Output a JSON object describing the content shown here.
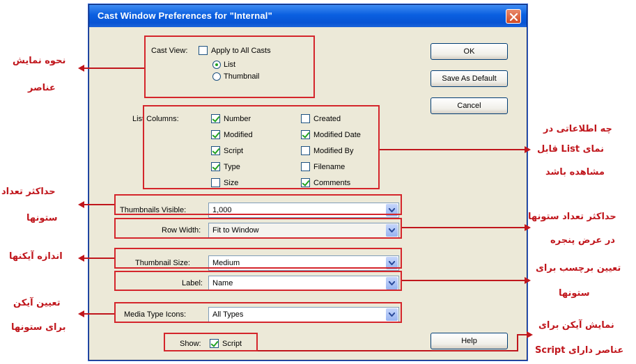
{
  "dialog": {
    "title": "Cast Window Preferences for \"Internal\"",
    "cast_view_label": "Cast View:",
    "apply_all_label": "Apply to All Casts",
    "apply_all_checked": false,
    "view_list_label": "List",
    "view_thumbnail_label": "Thumbnail",
    "selected_view": "List",
    "list_columns_label": "List Columns:",
    "columns": [
      {
        "label": "Number",
        "checked": true
      },
      {
        "label": "Modified",
        "checked": true
      },
      {
        "label": "Script",
        "checked": true
      },
      {
        "label": "Type",
        "checked": true
      },
      {
        "label": "Size",
        "checked": false
      },
      {
        "label": "Created",
        "checked": false
      },
      {
        "label": "Modified Date",
        "checked": true
      },
      {
        "label": "Modified By",
        "checked": false
      },
      {
        "label": "Filename",
        "checked": false
      },
      {
        "label": "Comments",
        "checked": true
      }
    ],
    "thumbnails_visible_label": "Thumbnails Visible:",
    "thumbnails_visible_value": "1,000",
    "row_width_label": "Row Width:",
    "row_width_value": "Fit to Window",
    "thumbnail_size_label": "Thumbnail Size:",
    "thumbnail_size_value": "Medium",
    "label_label": "Label:",
    "label_value": "Name",
    "media_type_icons_label": "Media Type Icons:",
    "media_type_icons_value": "All Types",
    "show_label": "Show:",
    "show_script_label": "Script",
    "show_script_checked": true,
    "ok_label": "OK",
    "save_default_label": "Save As Default",
    "cancel_label": "Cancel",
    "help_label": "Help"
  },
  "annotations": {
    "cast_view_line1": "نحوه نمایش",
    "cast_view_line2": "عناصر",
    "list_columns_line1": "چه اطلاعاتی در",
    "list_columns_line2": "نمای List قابل",
    "list_columns_line3": "مشاهده باشد",
    "thumbnails_line1": "حداکثر تعداد",
    "thumbnails_line2": "ستونها",
    "row_width_line1": "حداکثر تعداد ستونها",
    "row_width_line2": "در عرض پنجره",
    "thumb_size": "اندازه آیکنها",
    "label_line1": "تعیین برچسب برای",
    "label_line2": "ستونها",
    "media_line1": "تعیین آیکن",
    "media_line2": "برای ستونها",
    "script_line1": "نمایش آیکن برای",
    "script_line2": "عناصر دارای Script"
  },
  "colors": {
    "annotation_red": "#c0161c",
    "title_bar_blue": "#0a5fe0",
    "dialog_bg": "#ece9d8"
  }
}
